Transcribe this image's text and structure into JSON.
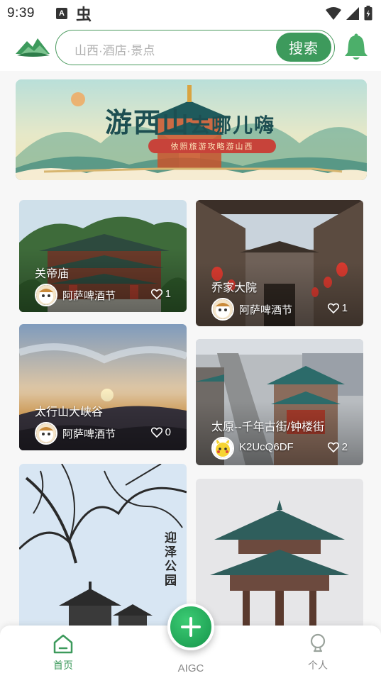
{
  "status_bar": {
    "time": "9:39",
    "a_label": "A",
    "bug_glyph": "虫"
  },
  "header": {
    "search_placeholder": "山西·酒店·景点",
    "search_button": "搜索"
  },
  "banner": {
    "title_main": "游西山",
    "title_tail": "去哪儿嗨",
    "subtitle": "依照旅游攻略游山西"
  },
  "cards": [
    {
      "title": "关帝庙",
      "author": "阿萨啤酒节",
      "likes": "1"
    },
    {
      "title": "乔家大院",
      "author": "阿萨啤酒节",
      "likes": "1"
    },
    {
      "title": "太行山大峡谷",
      "author": "阿萨啤酒节",
      "likes": "0"
    },
    {
      "title": "太原--千年古街/钟楼街",
      "author": "K2UcQ6DF",
      "likes": "2"
    },
    {
      "calligraphy": "迎泽公园"
    }
  ],
  "bottom_nav": {
    "home": "首页",
    "aigc": "AIGC",
    "profile": "个人"
  },
  "colors": {
    "brand_green": "#3d9a5c",
    "accent_green": "#21a557"
  },
  "icons": [
    "logo-icon",
    "bell-icon",
    "heart-icon",
    "home-icon",
    "plus-icon",
    "person-icon",
    "wifi-icon",
    "signal-icon",
    "battery-icon"
  ]
}
